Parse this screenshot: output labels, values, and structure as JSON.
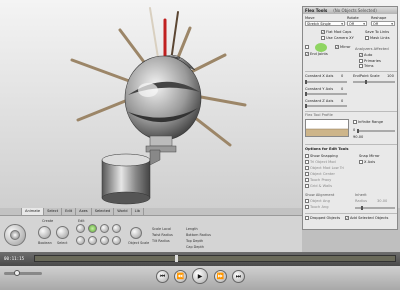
{
  "flex_panel": {
    "title": "Flex Tools",
    "subtitle": "(No Objects Selected)",
    "move_label": "Move",
    "move_value": "Stretch Single",
    "rotate_label": "Rotate",
    "rotate_value": "Off",
    "reshape_label": "Reshape",
    "reshape_value": "Off",
    "flat_label": "Flat Mod Caps",
    "use_camera_label": "Use Camera XY",
    "save_links_label": "Save To Links",
    "mask_links_label": "Mask Links",
    "mirror_label": "Mirror",
    "end_joints_label": "End Joints",
    "analyzers_label": "Analyzers Affected",
    "auto_label": "Auto",
    "primaries_label": "Primaries",
    "trims_label": "Trims",
    "cx_label": "Constant X Axis",
    "cx_value": "0",
    "endpoint_label": "EndPoint Scale",
    "endpoint_value": "100",
    "cy_label": "Constant Y Axis",
    "cy_value": "0",
    "cz_label": "Constant Z Axis",
    "cz_value": "0",
    "profile_label": "Flex Tool Profile",
    "infinite_label": "Infinite Range",
    "infinite_value": "0",
    "range_value": "90.00",
    "options_title": "Options for Edit Tools",
    "snap_mirror_label": "Snap Mirror",
    "show_snapping_label": "Show Snapping",
    "x_axis_label": "X Axis",
    "opt1": "Tri Object Mod",
    "opt2": "Object Mod Low Tri",
    "opt3": "Object Center",
    "opt4": "Touch Proxy",
    "opt5": "Grid & Walls",
    "show_alignment_label": "Show Alignment",
    "inherit_label": "Inherit",
    "object_ang_label": "Object Ang",
    "radius_label": "Radius",
    "radius_value": "30.00",
    "touch_ang_label": "Touch Ang",
    "dropped_label": "Dropped Objects",
    "add_selected_label": "Add Selected Objects"
  },
  "toolbar": {
    "tabs": [
      "",
      "Animate",
      "Select",
      "Edit",
      "Axes",
      "Selected",
      "World",
      "Lib"
    ],
    "active_tab": 1,
    "group_create": "Create",
    "group_edit": "Edit",
    "btn_boolean": "Boolean",
    "btn_select": "Select",
    "btn_object": "Object Scale",
    "scale_local": "Scale Local",
    "twist_radius": "Twist Radius",
    "tilt_radius": "Tilt Radius",
    "length_label": "Length",
    "bottom_radius": "Bottom Radius",
    "top_depth": "Top Depth",
    "cap_depth": "Cap Depth"
  },
  "timeline": {
    "time": "00:11:15"
  },
  "colors": {
    "accent_green": "#7fd14a",
    "scrubber": "#6a6a5a"
  }
}
